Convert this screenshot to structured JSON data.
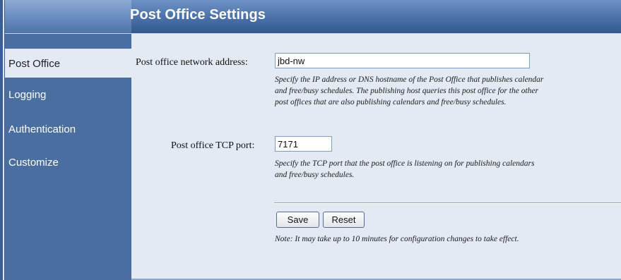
{
  "header": {
    "title": "Post Office Settings"
  },
  "sidebar": {
    "items": [
      {
        "label": "Post Office",
        "active": true
      },
      {
        "label": "Logging"
      },
      {
        "label": "Authentication"
      },
      {
        "label": "Customize"
      }
    ]
  },
  "form": {
    "address": {
      "label": "Post office network address:",
      "value": "jbd-nw",
      "help": [
        "Specify the IP address or DNS hostname of the Post Office that publishes calendar",
        "and free/busy schedules. The publishing host queries this post office for the other",
        "post offices that are also publishing calendars and free/busy schedules."
      ]
    },
    "port": {
      "label": "Post office TCP port:",
      "value": "7171",
      "help": [
        "Specify the TCP port that the post office is listening on for publishing calendars",
        "and free/busy schedules."
      ]
    },
    "buttons": {
      "save": "Save",
      "reset": "Reset"
    },
    "note": "Note: It may take up to 10 minutes for configuration changes to take effect."
  },
  "colors": {
    "sidebar": "#4a6e9f",
    "header": "#4d74ab",
    "content_bg": "#e4eaf3",
    "active_item_bg": "#e4eaf3"
  }
}
